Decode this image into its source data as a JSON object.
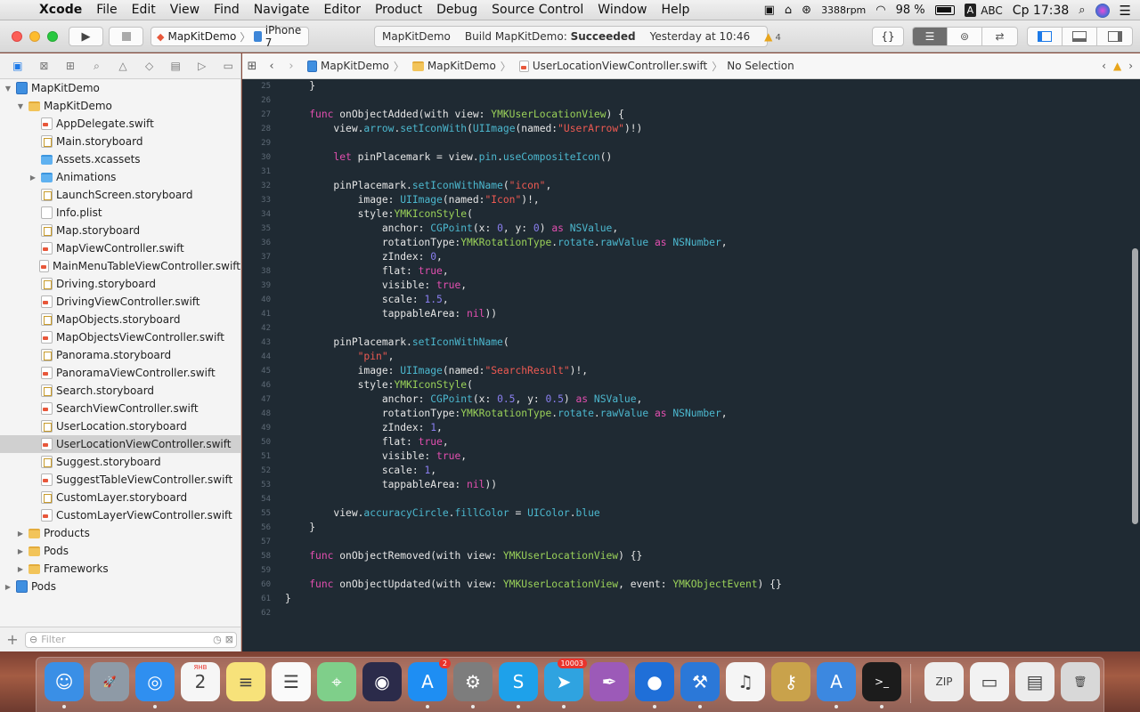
{
  "menubar": {
    "app": "Xcode",
    "items": [
      "File",
      "Edit",
      "View",
      "Find",
      "Navigate",
      "Editor",
      "Product",
      "Debug",
      "Source Control",
      "Window",
      "Help"
    ],
    "net_speed": "3388rpm",
    "battery": "98 %",
    "input": "A",
    "input_name": "ABC",
    "clock": "Ср 17:38"
  },
  "toolbar": {
    "scheme": "MapKitDemo",
    "device": "iPhone 7",
    "activity_project": "MapKitDemo",
    "activity_status_prefix": "Build MapKitDemo: ",
    "activity_status_bold": "Succeeded",
    "activity_time": "Yesterday at 10:46",
    "warning_count": "4"
  },
  "navigator": {
    "filter_placeholder": "Filter",
    "items": [
      {
        "label": "MapKitDemo",
        "icon": "proj",
        "indent": 0,
        "disclosure": "open"
      },
      {
        "label": "MapKitDemo",
        "icon": "folder",
        "indent": 1,
        "disclosure": "open"
      },
      {
        "label": "AppDelegate.swift",
        "icon": "swift",
        "indent": 2,
        "disclosure": ""
      },
      {
        "label": "Main.storyboard",
        "icon": "story",
        "indent": 2,
        "disclosure": ""
      },
      {
        "label": "Assets.xcassets",
        "icon": "bluefolder",
        "indent": 2,
        "disclosure": ""
      },
      {
        "label": "Animations",
        "icon": "bluefolder",
        "indent": 2,
        "disclosure": "closed"
      },
      {
        "label": "LaunchScreen.storyboard",
        "icon": "story",
        "indent": 2,
        "disclosure": ""
      },
      {
        "label": "Info.plist",
        "icon": "file",
        "indent": 2,
        "disclosure": ""
      },
      {
        "label": "Map.storyboard",
        "icon": "story",
        "indent": 2,
        "disclosure": ""
      },
      {
        "label": "MapViewController.swift",
        "icon": "swift",
        "indent": 2,
        "disclosure": ""
      },
      {
        "label": "MainMenuTableViewController.swift",
        "icon": "swift",
        "indent": 2,
        "disclosure": ""
      },
      {
        "label": "Driving.storyboard",
        "icon": "story",
        "indent": 2,
        "disclosure": ""
      },
      {
        "label": "DrivingViewController.swift",
        "icon": "swift",
        "indent": 2,
        "disclosure": ""
      },
      {
        "label": "MapObjects.storyboard",
        "icon": "story",
        "indent": 2,
        "disclosure": ""
      },
      {
        "label": "MapObjectsViewController.swift",
        "icon": "swift",
        "indent": 2,
        "disclosure": ""
      },
      {
        "label": "Panorama.storyboard",
        "icon": "story",
        "indent": 2,
        "disclosure": ""
      },
      {
        "label": "PanoramaViewController.swift",
        "icon": "swift",
        "indent": 2,
        "disclosure": ""
      },
      {
        "label": "Search.storyboard",
        "icon": "story",
        "indent": 2,
        "disclosure": ""
      },
      {
        "label": "SearchViewController.swift",
        "icon": "swift",
        "indent": 2,
        "disclosure": ""
      },
      {
        "label": "UserLocation.storyboard",
        "icon": "story",
        "indent": 2,
        "disclosure": ""
      },
      {
        "label": "UserLocationViewController.swift",
        "icon": "swift",
        "indent": 2,
        "disclosure": "",
        "selected": true
      },
      {
        "label": "Suggest.storyboard",
        "icon": "story",
        "indent": 2,
        "disclosure": ""
      },
      {
        "label": "SuggestTableViewController.swift",
        "icon": "swift",
        "indent": 2,
        "disclosure": ""
      },
      {
        "label": "CustomLayer.storyboard",
        "icon": "story",
        "indent": 2,
        "disclosure": ""
      },
      {
        "label": "CustomLayerViewController.swift",
        "icon": "swift",
        "indent": 2,
        "disclosure": ""
      },
      {
        "label": "Products",
        "icon": "folder",
        "indent": 1,
        "disclosure": "closed"
      },
      {
        "label": "Pods",
        "icon": "folder",
        "indent": 1,
        "disclosure": "closed"
      },
      {
        "label": "Frameworks",
        "icon": "folder",
        "indent": 1,
        "disclosure": "closed"
      },
      {
        "label": "Pods",
        "icon": "proj",
        "indent": 0,
        "disclosure": "closed"
      }
    ]
  },
  "jumpbar": {
    "crumbs": [
      "MapKitDemo",
      "MapKitDemo",
      "UserLocationViewController.swift",
      "No Selection"
    ]
  },
  "editor": {
    "lines": [
      {
        "n": "25",
        "code": "    }"
      },
      {
        "n": "26",
        "code": ""
      },
      {
        "n": "27",
        "code": "    <k>func</k> onObjectAdded(with view: <t>YMKUserLocationView</t>) {"
      },
      {
        "n": "28",
        "code": "        view.<m>arrow</m>.<m>setIconWith</m>(<m>UIImage</m>(named:<s>\"UserArrow\"</s>)!)"
      },
      {
        "n": "29",
        "code": ""
      },
      {
        "n": "30",
        "code": "        <k>let</k> pinPlacemark = view.<m>pin</m>.<m>useCompositeIcon</m>()"
      },
      {
        "n": "31",
        "code": ""
      },
      {
        "n": "32",
        "code": "        pinPlacemark.<m>setIconWithName</m>(<s>\"icon\"</s>,"
      },
      {
        "n": "33",
        "code": "            image: <m>UIImage</m>(named:<s>\"Icon\"</s>)!,"
      },
      {
        "n": "34",
        "code": "            style:<t>YMKIconStyle</t>("
      },
      {
        "n": "35",
        "code": "                anchor: <m>CGPoint</m>(x: <n>0</n>, y: <n>0</n>) <k>as</k> <m>NSValue</m>,"
      },
      {
        "n": "36",
        "code": "                rotationType:<t>YMKRotationType</t>.<m>rotate</m>.<m>rawValue</m> <k>as</k> <m>NSNumber</m>,"
      },
      {
        "n": "37",
        "code": "                zIndex: <n>0</n>,"
      },
      {
        "n": "38",
        "code": "                flat: <k>true</k>,"
      },
      {
        "n": "39",
        "code": "                visible: <k>true</k>,"
      },
      {
        "n": "40",
        "code": "                scale: <n>1.5</n>,"
      },
      {
        "n": "41",
        "code": "                tappableArea: <k>nil</k>))"
      },
      {
        "n": "42",
        "code": ""
      },
      {
        "n": "43",
        "code": "        pinPlacemark.<m>setIconWithName</m>("
      },
      {
        "n": "44",
        "code": "            <s>\"pin\"</s>,"
      },
      {
        "n": "45",
        "code": "            image: <m>UIImage</m>(named:<s>\"SearchResult\"</s>)!,"
      },
      {
        "n": "46",
        "code": "            style:<t>YMKIconStyle</t>("
      },
      {
        "n": "47",
        "code": "                anchor: <m>CGPoint</m>(x: <n>0.5</n>, y: <n>0.5</n>) <k>as</k> <m>NSValue</m>,"
      },
      {
        "n": "48",
        "code": "                rotationType:<t>YMKRotationType</t>.<m>rotate</m>.<m>rawValue</m> <k>as</k> <m>NSNumber</m>,"
      },
      {
        "n": "49",
        "code": "                zIndex: <n>1</n>,"
      },
      {
        "n": "50",
        "code": "                flat: <k>true</k>,"
      },
      {
        "n": "51",
        "code": "                visible: <k>true</k>,"
      },
      {
        "n": "52",
        "code": "                scale: <n>1</n>,"
      },
      {
        "n": "53",
        "code": "                tappableArea: <k>nil</k>))"
      },
      {
        "n": "54",
        "code": ""
      },
      {
        "n": "55",
        "code": "        view.<m>accuracyCircle</m>.<m>fillColor</m> = <m>UIColor</m>.<m>blue</m>"
      },
      {
        "n": "56",
        "code": "    }"
      },
      {
        "n": "57",
        "code": ""
      },
      {
        "n": "58",
        "code": "    <k>func</k> onObjectRemoved(with view: <t>YMKUserLocationView</t>) {}"
      },
      {
        "n": "59",
        "code": ""
      },
      {
        "n": "60",
        "code": "    <k>func</k> onObjectUpdated(with view: <t>YMKUserLocationView</t>, event: <t>YMKObjectEvent</t>) {}"
      },
      {
        "n": "61",
        "code": "}"
      },
      {
        "n": "62",
        "code": ""
      }
    ]
  },
  "dock": {
    "items": [
      {
        "name": "finder-icon",
        "color": "#3a8fe6",
        "glyph": "☺",
        "running": true
      },
      {
        "name": "launchpad-icon",
        "color": "#8e9aa6",
        "glyph": "🚀",
        "running": false
      },
      {
        "name": "safari-icon",
        "color": "#2f8ff0",
        "glyph": "◎",
        "running": true
      },
      {
        "name": "calendar-icon",
        "color": "#f6f6f6",
        "glyph": "2",
        "label": "ЯНВ",
        "running": false
      },
      {
        "name": "notes-icon",
        "color": "#f7e27a",
        "glyph": "≡",
        "running": false
      },
      {
        "name": "reminders-icon",
        "color": "#fafafa",
        "glyph": "☰",
        "running": false
      },
      {
        "name": "maps-icon",
        "color": "#7fcf8a",
        "glyph": "⌖",
        "running": false
      },
      {
        "name": "siri-icon",
        "color": "#2b2b4a",
        "glyph": "◉",
        "running": false
      },
      {
        "name": "app-store-icon",
        "color": "#1e8ef3",
        "glyph": "A",
        "badge": "2",
        "running": true
      },
      {
        "name": "system-preferences-icon",
        "color": "#7d7d7d",
        "glyph": "⚙",
        "running": true
      },
      {
        "name": "skype-icon",
        "color": "#1ea1ea",
        "glyph": "S",
        "running": true
      },
      {
        "name": "telegram-icon",
        "color": "#2fa3e0",
        "glyph": "➤",
        "badge": "10003",
        "running": true
      },
      {
        "name": "quill-icon",
        "color": "#9c5ab8",
        "glyph": "✒",
        "running": false
      },
      {
        "name": "maps-pin-icon",
        "color": "#1f6fd8",
        "glyph": "●",
        "running": true
      },
      {
        "name": "xcode-icon",
        "color": "#2b78d8",
        "glyph": "⚒",
        "running": true
      },
      {
        "name": "itunes-icon",
        "color": "#f5f5f5",
        "glyph": "♫",
        "running": false
      },
      {
        "name": "keychain-icon",
        "color": "#c9a24b",
        "glyph": "⚷",
        "running": false
      },
      {
        "name": "simulator-icon",
        "color": "#3c88e0",
        "glyph": "A",
        "running": true
      },
      {
        "name": "terminal-icon",
        "color": "#1c1c1c",
        "glyph": ">_",
        "running": true
      },
      {
        "name": "archive-icon",
        "color": "#eeeeee",
        "glyph": "ZIP",
        "running": false
      },
      {
        "name": "document-icon",
        "color": "#f2f2f2",
        "glyph": "▭",
        "running": false
      },
      {
        "name": "screenshot-icon",
        "color": "#ececec",
        "glyph": "▤",
        "running": false
      },
      {
        "name": "trash-icon",
        "color": "#d8d8d8",
        "glyph": "🗑",
        "running": false
      }
    ]
  }
}
